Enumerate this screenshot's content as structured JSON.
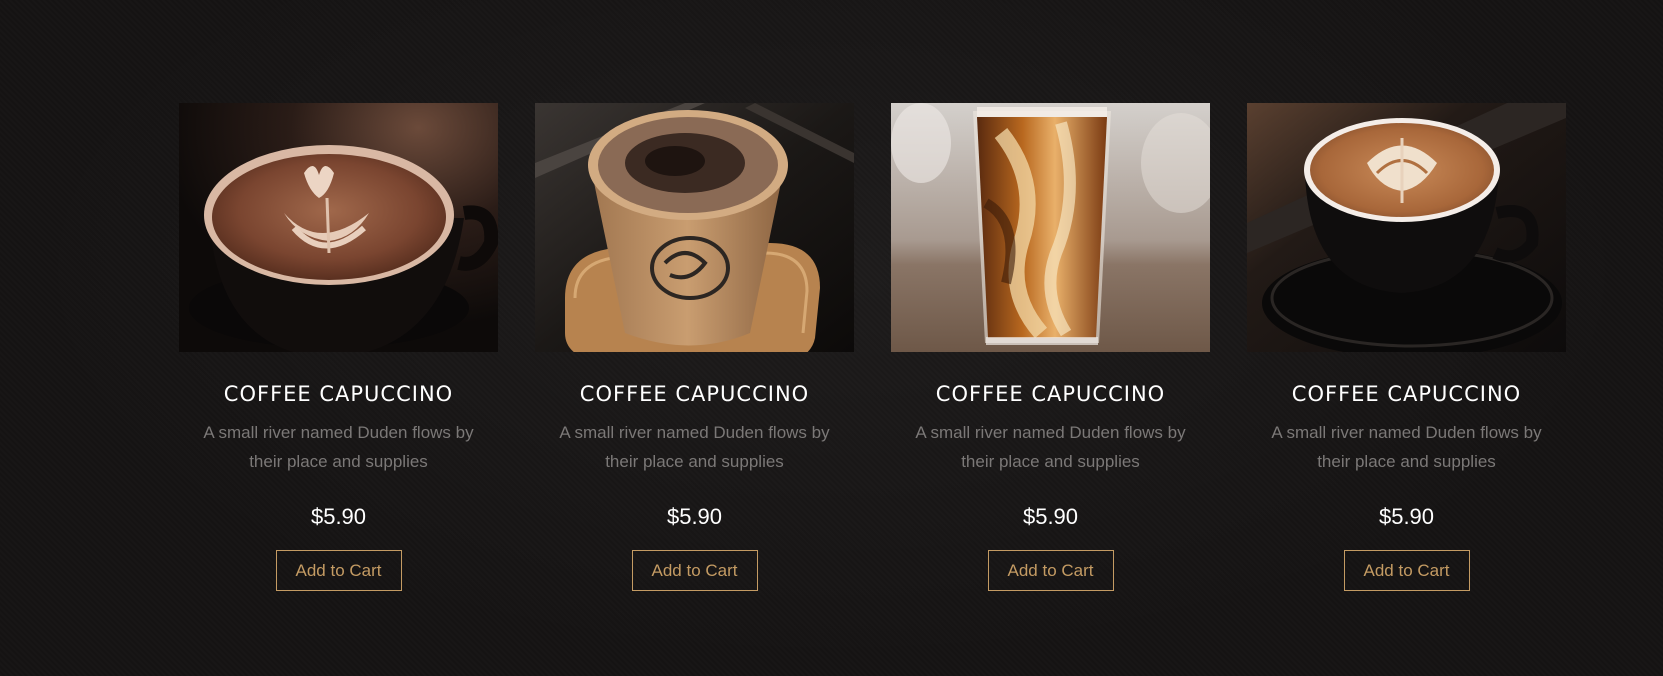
{
  "products": [
    {
      "image": "latte-art-heart-cup",
      "title": "COFFEE CAPUCCINO",
      "description": "A small river named Duden flows by their place and supplies",
      "price": "$5.90",
      "button_label": "Add to Cart"
    },
    {
      "image": "paper-cup-on-wood-coaster",
      "title": "COFFEE CAPUCCINO",
      "description": "A small river named Duden flows by their place and supplies",
      "price": "$5.90",
      "button_label": "Add to Cart"
    },
    {
      "image": "iced-coffee-glass",
      "title": "COFFEE CAPUCCINO",
      "description": "A small river named Duden flows by their place and supplies",
      "price": "$5.90",
      "button_label": "Add to Cart"
    },
    {
      "image": "latte-art-black-cup-saucer",
      "title": "COFFEE CAPUCCINO",
      "description": "A small river named Duden flows by their place and supplies",
      "price": "$5.90",
      "button_label": "Add to Cart"
    }
  ],
  "colors": {
    "background": "#151313",
    "accent": "#c49b63",
    "title": "#ffffff",
    "description": "#7b7877"
  }
}
